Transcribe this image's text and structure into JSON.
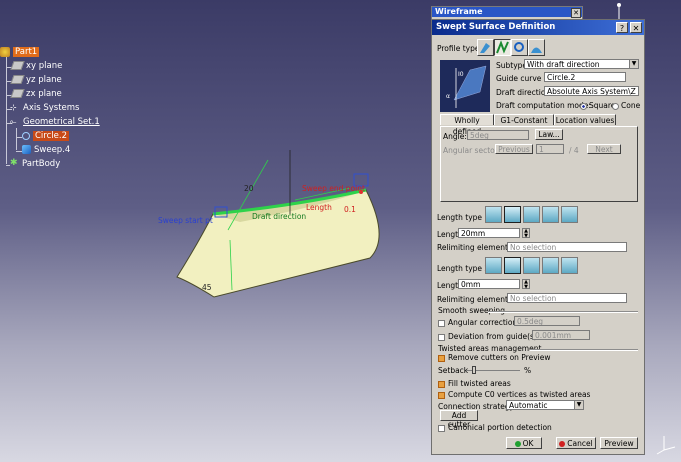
{
  "tree": {
    "root": "Part1",
    "items": [
      {
        "label": "xy plane"
      },
      {
        "label": "yz plane"
      },
      {
        "label": "zx plane"
      },
      {
        "label": "Axis Systems"
      },
      {
        "label": "Geometrical Set.1"
      },
      {
        "label": "Circle.2"
      },
      {
        "label": "Sweep.4"
      },
      {
        "label": "PartBody"
      }
    ]
  },
  "model": {
    "labels": {
      "angle20": "20",
      "angle45": "45",
      "sweep_start": "Sweep start pt",
      "sweep_end": "Sweep end point",
      "draft_direction": "Draft direction",
      "length": "Length",
      "ang_value": "0.1"
    }
  },
  "toolbar": {
    "title": "Wireframe"
  },
  "dialog": {
    "title": "Swept Surface Definition",
    "profile_type_label": "Profile type:",
    "subtype_label": "Subtype:",
    "subtype_value": "With draft direction",
    "guide_curve_label": "Guide curve 1:",
    "guide_curve_value": "Circle.2",
    "draft_direction_label": "Draft direction:",
    "draft_direction_value": "Absolute Axis System\\Z",
    "draft_mode_label": "Draft computation mode:",
    "mode_square": "Square",
    "mode_cone": "Cone",
    "tabs": [
      "Wholly defined",
      "G1-Constant",
      "Location values"
    ],
    "angle_label": "Angle:",
    "angle_value": "5deg",
    "law_button": "Law...",
    "angular_sector_label": "Angular sector:",
    "previous_button": "Previous",
    "sector_value": "1",
    "sector_total": "/ 4",
    "next_button": "Next",
    "length_type1_label": "Length type 1:",
    "length1_label": "Length 1:",
    "length1_value": "20mm",
    "relimiting1_label": "Relimiting element 1:",
    "relimiting1_value": "No selection",
    "length_type2_label": "Length type 2:",
    "length2_label": "Length 2:",
    "length2_value": "0mm",
    "relimiting2_label": "Relimiting element 2:",
    "relimiting2_value": "No selection",
    "smooth_header": "Smooth sweeping",
    "angular_correction_label": "Angular correction:",
    "angular_correction_value": "0.5deg",
    "deviation_label": "Deviation from guide(s):",
    "deviation_value": "0.001mm",
    "twisted_header": "Twisted areas management",
    "remove_cutters": "Remove cutters on Preview",
    "setback_label": "Setback",
    "setback_unit": "%",
    "fill_twisted": "Fill twisted areas",
    "compute_c0": "Compute C0 vertices as twisted areas",
    "connection_label": "Connection strategy:",
    "connection_value": "Automatic",
    "add_cutter": "Add cutter",
    "canonical": "Canonical portion detection",
    "ok": "OK",
    "cancel": "Cancel",
    "preview": "Preview"
  }
}
